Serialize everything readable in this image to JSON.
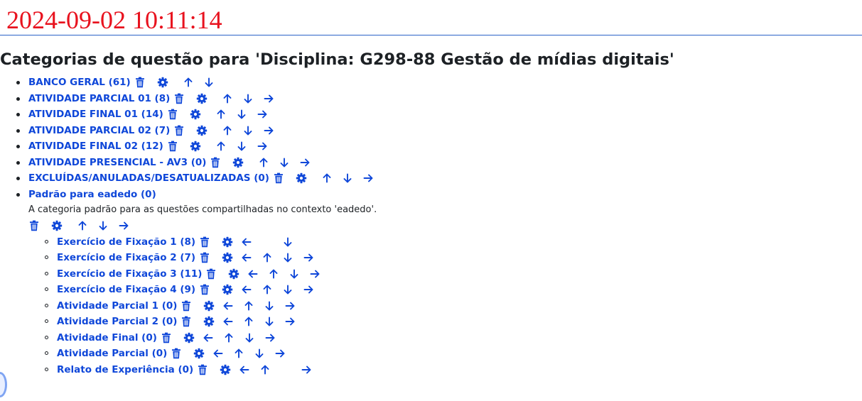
{
  "clock": "2024-09-02 10:11:14",
  "page_title": "Categorias de questão para 'Disciplina: G298-88 Gestão de mídias digitais'",
  "colors": {
    "link": "#0f47d9",
    "clock": "#e8121e",
    "rule": "#2b62c8"
  },
  "icons": {
    "delete": "trash-icon",
    "edit": "gear-icon",
    "left": "arrow-left-icon",
    "up": "arrow-up-icon",
    "down": "arrow-down-icon",
    "right": "arrow-right-icon"
  },
  "categories": [
    {
      "label": "BANCO GERAL (61)",
      "actions": [
        "up",
        "down"
      ]
    },
    {
      "label": "ATIVIDADE PARCIAL 01 (8)",
      "actions": [
        "up",
        "down",
        "right"
      ]
    },
    {
      "label": "ATIVIDADE FINAL 01 (14)",
      "actions": [
        "up",
        "down",
        "right"
      ]
    },
    {
      "label": "ATIVIDADE PARCIAL 02 (7)",
      "actions": [
        "up",
        "down",
        "right"
      ]
    },
    {
      "label": "ATIVIDADE FINAL 02 (12)",
      "actions": [
        "up",
        "down",
        "right"
      ]
    },
    {
      "label": "ATIVIDADE PRESENCIAL - AV3 (0)",
      "actions": [
        "up",
        "down",
        "right"
      ]
    },
    {
      "label": "EXCLUÍDAS/ANULADAS/DESATUALIZADAS (0)",
      "actions": [
        "up",
        "down",
        "right"
      ]
    }
  ],
  "default_category": {
    "label": "Padrão para eadedo (0)",
    "description": "A categoria padrão para as questões compartilhadas no contexto 'eadedo'.",
    "actions": [
      "up",
      "down",
      "right"
    ],
    "children": [
      {
        "label": "Exercício de Fixação 1 (8)",
        "actions": [
          "left",
          "",
          "down"
        ]
      },
      {
        "label": "Exercício de Fixação 2 (7)",
        "actions": [
          "left",
          "up",
          "down",
          "right"
        ]
      },
      {
        "label": "Exercício de Fixação 3 (11)",
        "actions": [
          "left",
          "up",
          "down",
          "right"
        ]
      },
      {
        "label": "Exercício de Fixação 4 (9)",
        "actions": [
          "left",
          "up",
          "down",
          "right"
        ]
      },
      {
        "label": "Atividade Parcial 1 (0)",
        "actions": [
          "left",
          "up",
          "down",
          "right"
        ]
      },
      {
        "label": "Atividade Parcial 2 (0)",
        "actions": [
          "left",
          "up",
          "down",
          "right"
        ]
      },
      {
        "label": "Atividade Final (0)",
        "actions": [
          "left",
          "up",
          "down",
          "right"
        ]
      },
      {
        "label": "Atividade Parcial (0)",
        "actions": [
          "left",
          "up",
          "down",
          "right"
        ]
      },
      {
        "label": "Relato de Experiência (0)",
        "actions": [
          "left",
          "up",
          "",
          "right"
        ]
      }
    ]
  }
}
